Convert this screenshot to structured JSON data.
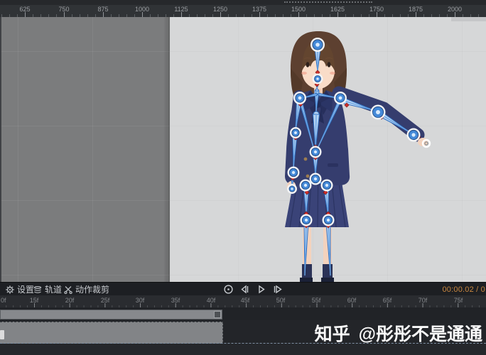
{
  "top_ruler": {
    "labels": [
      "625",
      "750",
      "875",
      "1000",
      "1125",
      "1250",
      "1375",
      "1500",
      "1625",
      "1750",
      "1875",
      "2000"
    ]
  },
  "toolbar": {
    "settings_label": "设置",
    "track_label": "轨道",
    "action_crop_label": "动作裁剪",
    "timecode": "00:00.02 / 0"
  },
  "frame_ruler": {
    "labels": [
      "0f",
      "15f",
      "20f",
      "25f",
      "30f",
      "35f",
      "40f",
      "45f",
      "50f",
      "55f",
      "60f",
      "65f",
      "70f",
      "75f"
    ]
  },
  "watermark": {
    "site": "知乎",
    "user": "@彤彤不是通通"
  },
  "colors": {
    "timecode_orange": "#c9873f",
    "bone_fill_blue": "#b7d4f2",
    "bone_stroke_blue": "#2e6fc2",
    "joint_blue": "#4489d8",
    "marker_red": "#d32f28",
    "uniform_navy": "#353d6e",
    "stage_gray": "#d6d7d8",
    "workspace_gray": "#7b7c7d"
  }
}
